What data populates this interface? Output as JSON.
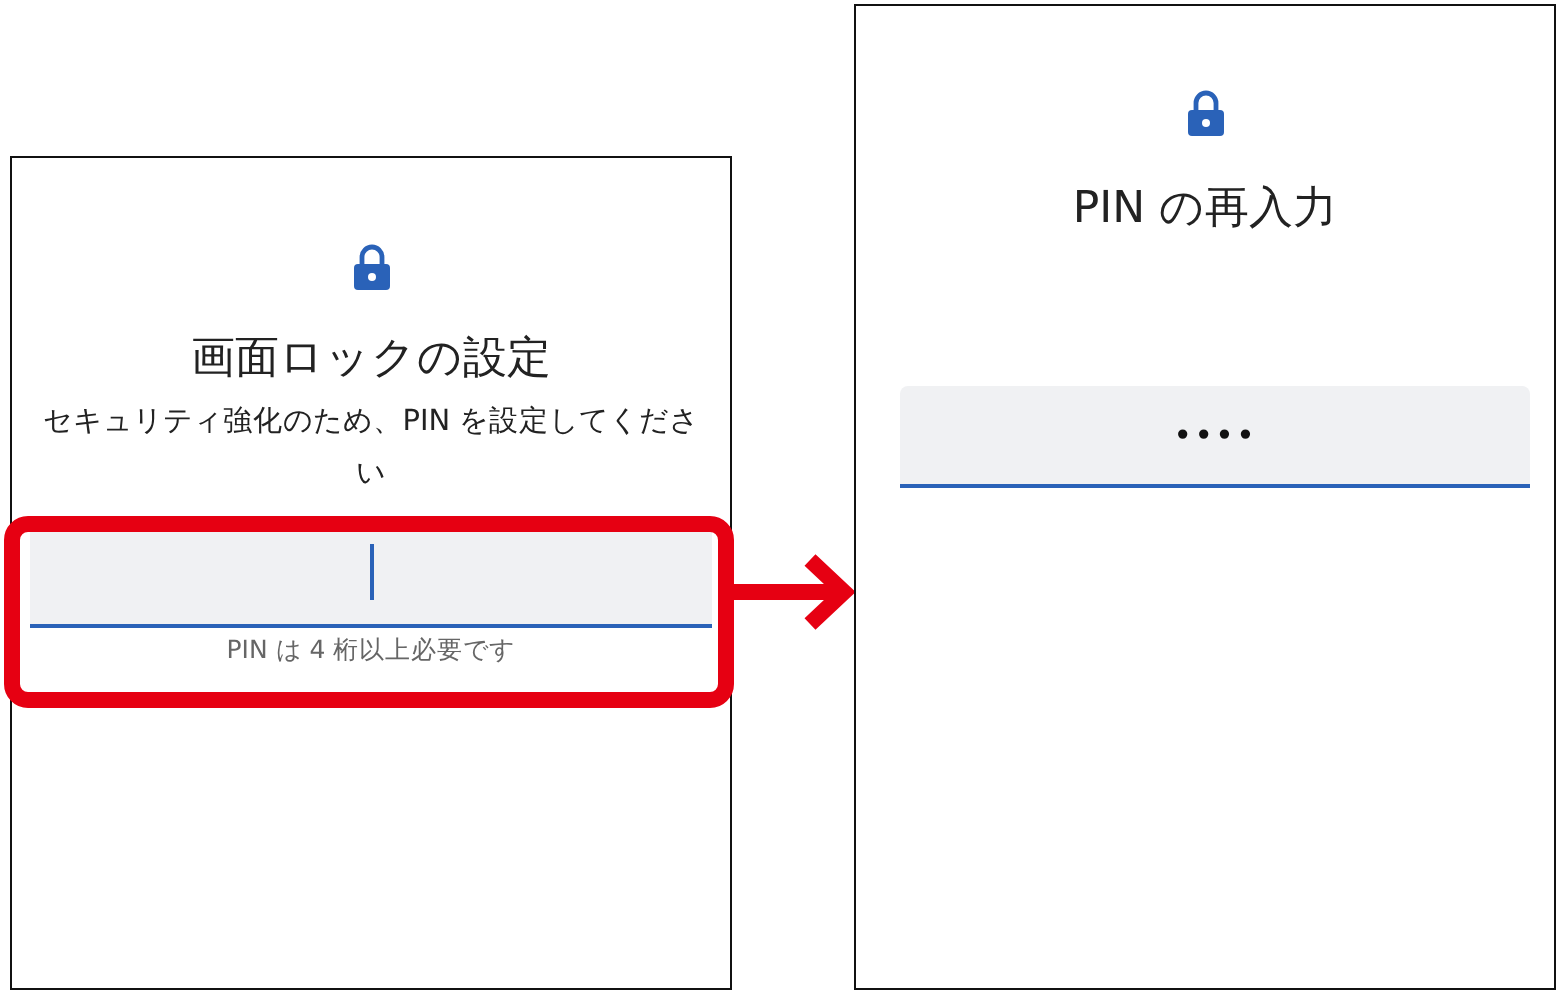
{
  "screens": [
    {
      "title": "画面ロックの設定",
      "subtitle": "セキュリティ強化のため、PIN を設定してください",
      "pin_field": {
        "focused": true
      },
      "hint": "PIN は 4 桁以上必要です",
      "highlighted": true
    },
    {
      "title": "PIN の再入力",
      "pin_field": {
        "value": "••••",
        "focused": false
      },
      "highlighted": false
    }
  ]
}
